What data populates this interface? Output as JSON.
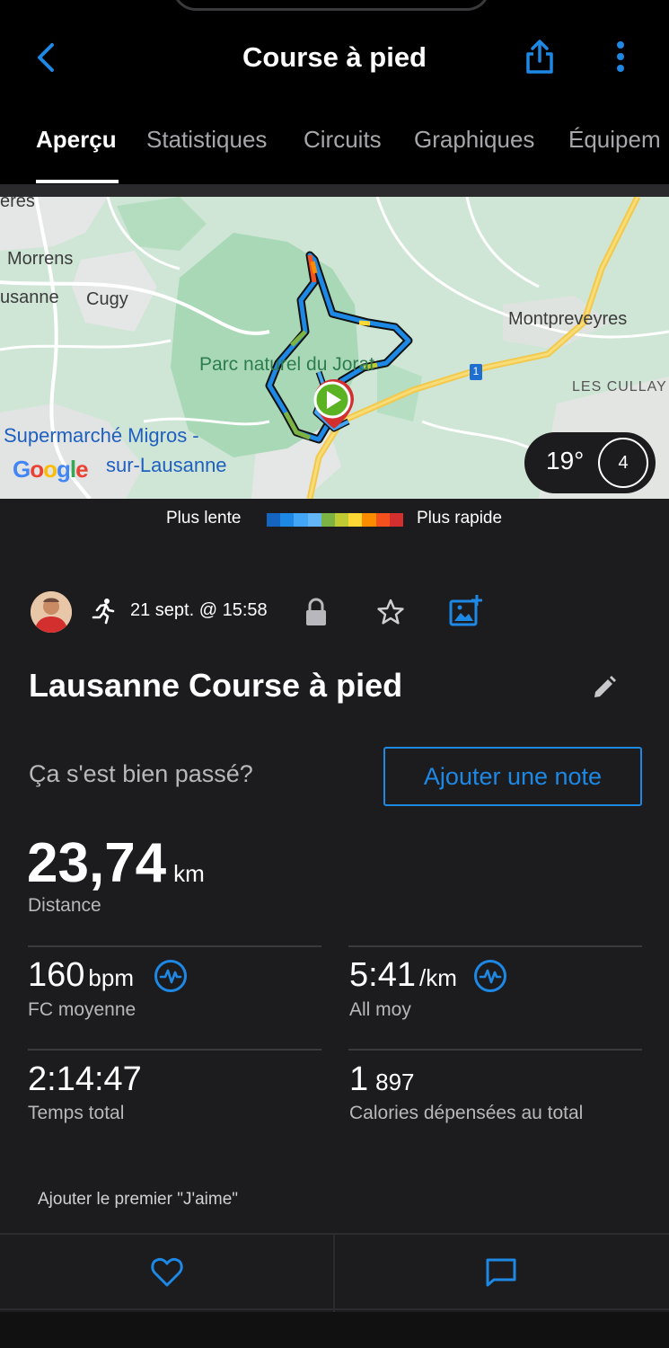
{
  "header": {
    "title": "Course à pied",
    "back_icon": "chevron-left-icon",
    "share_icon": "share-icon",
    "more_icon": "more-vertical-icon"
  },
  "tabs": [
    {
      "label": "Aperçu",
      "active": true
    },
    {
      "label": "Statistiques",
      "active": false
    },
    {
      "label": "Circuits",
      "active": false
    },
    {
      "label": "Graphiques",
      "active": false
    },
    {
      "label": "Équipem",
      "active": false
    }
  ],
  "map": {
    "labels": {
      "eres": "eres",
      "morrens": "Morrens",
      "lausanne": "usanne",
      "cugy": "Cugy",
      "montpreveyres": "Montpreveyres",
      "park": "Parc naturel du Jorat",
      "cullay": "LES CULLAY",
      "poi_line1": "Supermarché Migros -",
      "poi_line2": "sur-Lausanne",
      "road": "1",
      "attribution": "Google"
    },
    "weather": {
      "temperature": "19°",
      "wind": "4"
    }
  },
  "legend": {
    "slow": "Plus lente",
    "fast": "Plus rapide",
    "colors": [
      "#1565c0",
      "#1e88e5",
      "#42a5f5",
      "#64b5f6",
      "#7cb342",
      "#c0ca33",
      "#fdd835",
      "#fb8c00",
      "#f4511e",
      "#d32f2f"
    ]
  },
  "meta": {
    "date": "21 sept. @ 15:58",
    "activity_icon": "running-icon",
    "privacy_icon": "lock-icon",
    "favorite_icon": "star-icon",
    "photo_icon": "add-photo-icon"
  },
  "activity": {
    "title": "Lausanne Course à pied",
    "edit_icon": "pencil-icon"
  },
  "note": {
    "prompt": "Ça s'est bien passé?",
    "button": "Ajouter une note"
  },
  "distance": {
    "value": "23,74",
    "unit": "km",
    "label": "Distance"
  },
  "stats": {
    "hr": {
      "value": "160",
      "unit": "bpm",
      "label": "FC moyenne"
    },
    "pace": {
      "value": "5:41",
      "unit": "/km",
      "label": "All moy"
    },
    "time": {
      "value": "2:14:47",
      "label": "Temps total"
    },
    "calories": {
      "value_main": "1",
      "value_rest": "897",
      "label": "Calories dépensées au total"
    }
  },
  "social": {
    "likes_text": "Ajouter le premier \"J'aime\"",
    "like_icon": "heart-icon",
    "comment_icon": "comment-icon"
  },
  "colors": {
    "accent": "#1e88e5",
    "background": "#1c1c1e",
    "header": "#000000"
  }
}
